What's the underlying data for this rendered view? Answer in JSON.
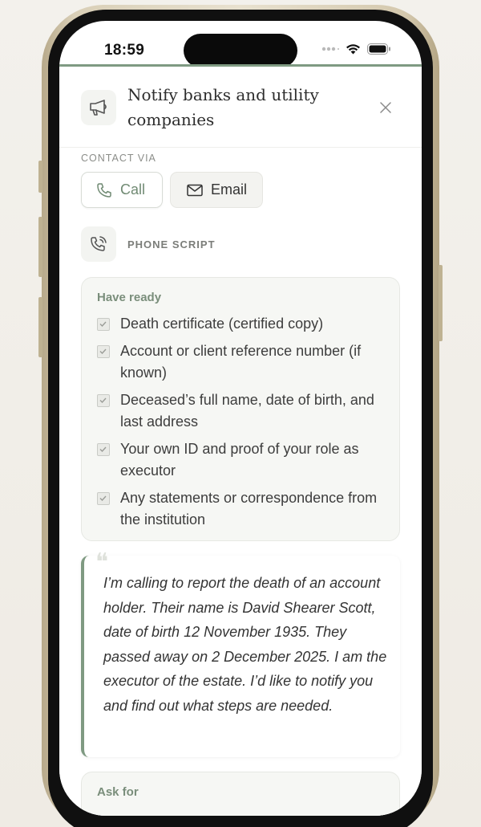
{
  "status_bar": {
    "time": "18:59"
  },
  "header": {
    "title": "Notify banks and utility companies"
  },
  "contact": {
    "label": "CONTACT VIA",
    "call_label": "Call",
    "email_label": "Email"
  },
  "script": {
    "label": "PHONE SCRIPT"
  },
  "have_ready": {
    "title": "Have ready",
    "items": [
      "Death certificate (certified copy)",
      "Account or client reference number (if known)",
      "Deceased’s full name, date of birth, and last address",
      "Your own ID and proof of your role as executor",
      "Any statements or correspondence from the institution"
    ]
  },
  "quote": {
    "mark": "❝",
    "text": "I’m calling to report the death of an account holder. Their name is David Shearer Scott, date of birth 12 November 1935. They passed away on 2 December 2025. I am the executor of the estate. I’d like to notify you and find out what steps are needed."
  },
  "ask_for": {
    "title": "Ask for"
  },
  "colors": {
    "accent": "#7f9a82",
    "accent_text": "#708a73",
    "card_bg": "#f6f7f4"
  },
  "icons": [
    "megaphone-icon",
    "close-icon",
    "phone-icon",
    "mail-icon",
    "phone-call-icon",
    "checkbox-icon",
    "wifi-icon",
    "battery-icon",
    "signal-icon"
  ]
}
